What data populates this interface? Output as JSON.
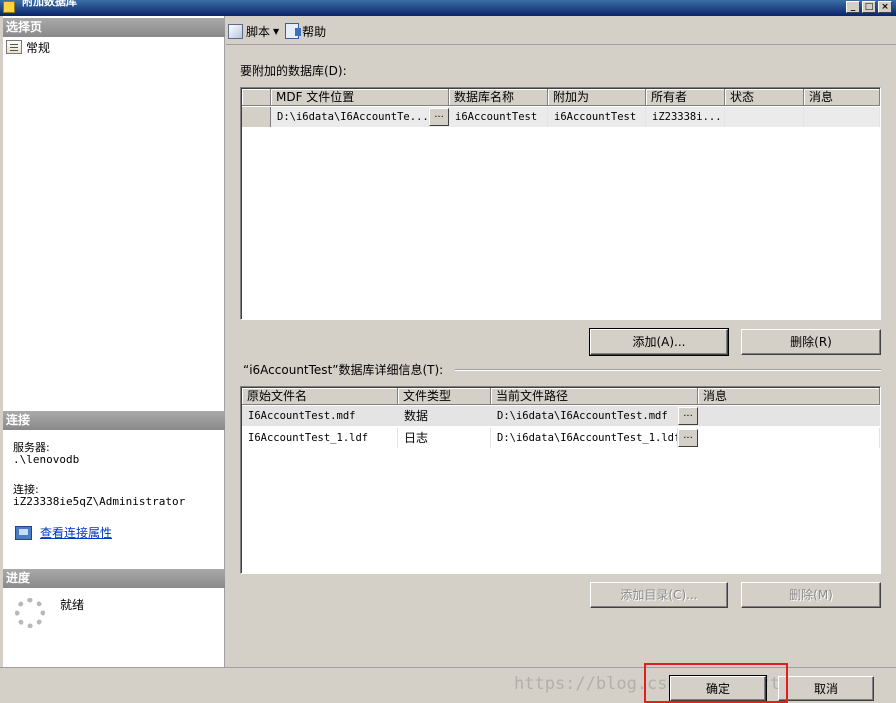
{
  "window": {
    "title": "附加数据库",
    "controls": [
      "_",
      "□",
      "×"
    ]
  },
  "left": {
    "select_page_header": "选择页",
    "nav_item": "常规",
    "connection_header": "连接",
    "server_label": "服务器:",
    "server_value": ".\\lenovodb",
    "connection_label": "连接:",
    "connection_value": "iZ23338ie5qZ\\Administrator",
    "view_props_link": "查看连接属性",
    "progress_header": "进度",
    "progress_status": "就绪"
  },
  "toolbar": {
    "script_label": "脚本",
    "help_label": "帮助"
  },
  "attach": {
    "label": "要附加的数据库(D):",
    "columns": [
      "MDF 文件位置",
      "数据库名称",
      "附加为",
      "所有者",
      "状态",
      "消息"
    ],
    "rows": [
      {
        "mdf": "D:\\i6data\\I6AccountTe...",
        "dbname": "i6AccountTest",
        "attach_as": "i6AccountTest",
        "owner": "iZ23338i...",
        "status": "",
        "message": ""
      }
    ],
    "add_button": "添加(A)...",
    "remove_button": "删除(R)"
  },
  "details": {
    "label": "“i6AccountTest”数据库详细信息(T):",
    "columns": [
      "原始文件名",
      "文件类型",
      "当前文件路径",
      "消息"
    ],
    "rows": [
      {
        "name": "I6AccountTest.mdf",
        "type": "数据",
        "path": "D:\\i6data\\I6AccountTest.mdf",
        "message": ""
      },
      {
        "name": "I6AccountTest_1.ldf",
        "type": "日志",
        "path": "D:\\i6data\\I6AccountTest_1.ldf",
        "message": ""
      }
    ],
    "add_catalog_button": "添加目录(C)...",
    "remove_button": "删除(M)"
  },
  "footer": {
    "ok_button": "确定",
    "cancel_button": "取消",
    "watermark": "https://blog.csdn.net/software1989"
  },
  "ellipsis": "..."
}
